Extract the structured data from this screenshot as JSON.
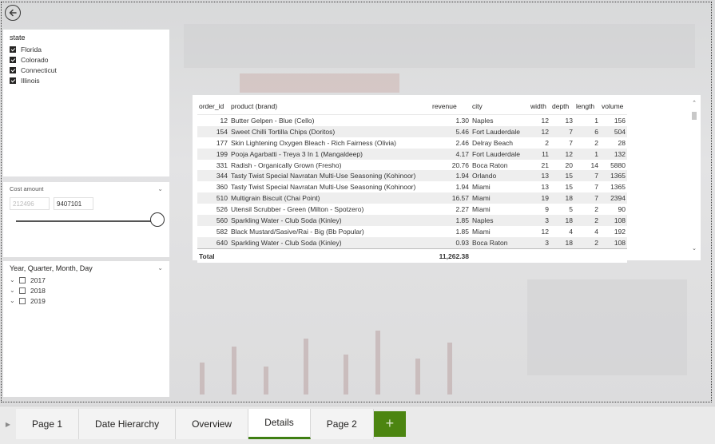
{
  "state_slicer": {
    "title": "state",
    "items": [
      "Florida",
      "Colorado",
      "Connecticut",
      "Illinois"
    ]
  },
  "cost_slicer": {
    "title": "Cost amount",
    "min_value": "212496",
    "max_value": "9407101"
  },
  "date_slicer": {
    "title": "Year, Quarter, Month, Day",
    "years": [
      "2017",
      "2018",
      "2019"
    ]
  },
  "table": {
    "columns": [
      "order_id",
      "product (brand)",
      "revenue",
      "city",
      "width",
      "depth",
      "length",
      "volume"
    ],
    "rows": [
      [
        "12",
        "Butter Gelpen - Blue (Cello)",
        "1.30",
        "Naples",
        "12",
        "13",
        "1",
        "156"
      ],
      [
        "154",
        "Sweet Chilli Tortilla Chips (Doritos)",
        "5.46",
        "Fort Lauderdale",
        "12",
        "7",
        "6",
        "504"
      ],
      [
        "177",
        "Skin Lightening Oxygen Bleach - Rich Fairness (Olivia)",
        "2.46",
        "Delray Beach",
        "2",
        "7",
        "2",
        "28"
      ],
      [
        "199",
        "Pooja Agarbatti - Treya 3 In 1 (Mangaldeep)",
        "4.17",
        "Fort Lauderdale",
        "11",
        "12",
        "1",
        "132"
      ],
      [
        "331",
        "Radish - Organically Grown (Fresho)",
        "20.76",
        "Boca Raton",
        "21",
        "20",
        "14",
        "5880"
      ],
      [
        "344",
        "Tasty Twist Special Navratan Multi-Use Seasoning (Kohinoor)",
        "1.94",
        "Orlando",
        "13",
        "15",
        "7",
        "1365"
      ],
      [
        "360",
        "Tasty Twist Special Navratan Multi-Use Seasoning (Kohinoor)",
        "1.94",
        "Miami",
        "13",
        "15",
        "7",
        "1365"
      ],
      [
        "510",
        "Multigrain Biscuit (Chai Point)",
        "16.57",
        "Miami",
        "19",
        "18",
        "7",
        "2394"
      ],
      [
        "526",
        "Utensil Scrubber - Green (Milton - Spotzero)",
        "2.27",
        "Miami",
        "9",
        "5",
        "2",
        "90"
      ],
      [
        "560",
        "Sparkling Water - Club Soda (Kinley)",
        "1.85",
        "Naples",
        "3",
        "18",
        "2",
        "108"
      ],
      [
        "582",
        "Black Mustard/Sasive/Rai - Big (Bb Popular)",
        "1.85",
        "Miami",
        "12",
        "4",
        "4",
        "192"
      ],
      [
        "640",
        "Sparkling Water - Club Soda (Kinley)",
        "0.93",
        "Boca Raton",
        "3",
        "18",
        "2",
        "108"
      ]
    ],
    "total_label": "Total",
    "total_revenue": "11,262.38"
  },
  "tabs": [
    "Page 1",
    "Date Hierarchy",
    "Overview",
    "Details",
    "Page 2"
  ],
  "active_tab": "Details",
  "add_tab_label": "+",
  "colors": {
    "accent": "#4c8511",
    "active_underline": "#3f7f13"
  }
}
